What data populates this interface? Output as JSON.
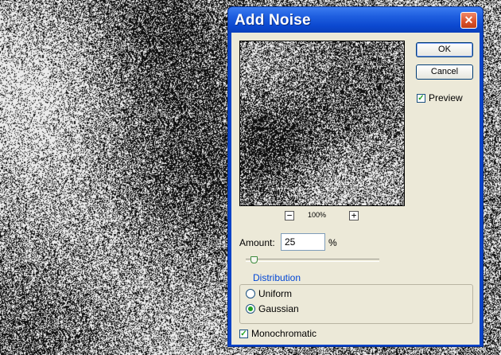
{
  "dialog": {
    "title": "Add Noise",
    "buttons": {
      "ok": "OK",
      "cancel": "Cancel"
    },
    "preview_checkbox": {
      "label": "Preview",
      "checked": true
    },
    "zoom": {
      "minus": "−",
      "plus": "+",
      "level": "100%"
    },
    "amount": {
      "label": "Amount:",
      "value": "25",
      "unit": "%",
      "slider_fraction": 0.06
    },
    "distribution": {
      "title": "Distribution",
      "options": [
        {
          "label": "Uniform",
          "selected": false
        },
        {
          "label": "Gaussian",
          "selected": true
        }
      ]
    },
    "monochromatic": {
      "label": "Monochromatic",
      "checked": true
    }
  },
  "icons": {
    "close": "close-icon",
    "check": "checkmark-icon"
  },
  "colors": {
    "title_bar": "#0a43c8",
    "dialog_face": "#ece9d8",
    "group_title": "#0046d5",
    "check": "#21a121"
  }
}
